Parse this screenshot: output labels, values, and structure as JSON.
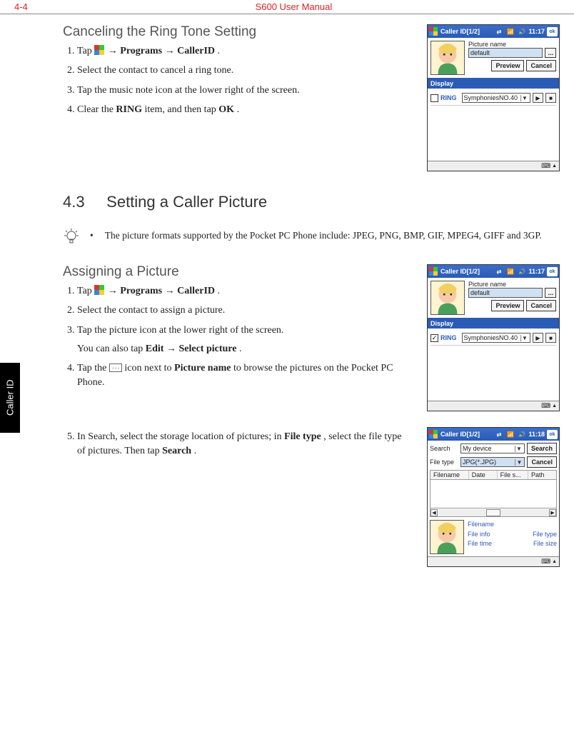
{
  "header": {
    "page_num": "4-4",
    "manual_title": "S600 User Manual"
  },
  "side_tab": "Caller ID",
  "section1": {
    "title": "Canceling the Ring Tone Setting",
    "steps": {
      "s1a": "Tap ",
      "s1b": " → ",
      "s1_prog": "Programs",
      "s1c": " → ",
      "s1_cid": "CallerID",
      "s1d": ".",
      "s2": "Select the contact to cancel a ring tone.",
      "s3": "Tap the music note icon at the lower right of the screen.",
      "s4a": "Clear the ",
      "s4_ring": "RING",
      "s4b": " item, and then tap ",
      "s4_ok": "OK",
      "s4c": "."
    }
  },
  "section_num": {
    "num": "4.3",
    "title": "Setting a Caller Picture"
  },
  "note": {
    "bullet": "•",
    "text": "The picture formats supported by the Pocket PC Phone include: JPEG, PNG, BMP, GIF, MPEG4, GIFF and 3GP."
  },
  "section2": {
    "title": "Assigning a Picture",
    "steps": {
      "s1a": "Tap ",
      "s1b": " → ",
      "s1_prog": "Programs",
      "s1c": " → ",
      "s1_cid": "CallerID",
      "s1d": ".",
      "s2": "Select the contact to assign a picture.",
      "s3": "Tap the picture icon at the lower right of the screen.",
      "s3sub_a": "You can also tap ",
      "s3sub_edit": "Edit",
      "s3sub_b": " → ",
      "s3sub_sel": "Select picture",
      "s3sub_c": ".",
      "s4a": "Tap the ",
      "s4b": " icon next to ",
      "s4_pn": "Picture name",
      "s4c": " to browse the pictures on the Pocket PC Phone.",
      "s5a": "In Search, select the storage location of pictures; in ",
      "s5_ft": "File type",
      "s5b": ", select the file type of pictures. Then tap ",
      "s5_search": "Search",
      "s5c": "."
    }
  },
  "shot1": {
    "title": "Caller ID[1/2]",
    "time": "11:17",
    "picture_name_label": "Picture name",
    "picture_name_value": "default",
    "preview_btn": "Preview",
    "cancel_btn": "Cancel",
    "display_label": "Display",
    "ring_checked": false,
    "ring_label": "RING",
    "ring_value": "SymphoniesNO.40",
    "ok": "ok"
  },
  "shot2": {
    "title": "Caller ID[1/2]",
    "time": "11:17",
    "picture_name_label": "Picture name",
    "picture_name_value": "default",
    "preview_btn": "Preview",
    "cancel_btn": "Cancel",
    "display_label": "Display",
    "ring_checked": true,
    "ring_label": "RING",
    "ring_value": "SymphoniesNO.40",
    "ok": "ok"
  },
  "shot3": {
    "title": "Caller ID[1/2]",
    "time": "11:18",
    "search_label": "Search",
    "search_value": "My device",
    "search_btn": "Search",
    "filetype_label": "File type",
    "filetype_value": "JPG(*.JPG)",
    "cancel_btn": "Cancel",
    "col_filename": "Filename",
    "col_date": "Date",
    "col_filesize": "File s...",
    "col_path": "Path",
    "detail_filename": "Filename",
    "detail_fileinfo": "File info",
    "detail_filetype": "File type",
    "detail_filetime": "File time",
    "detail_filesize": "File size",
    "ok": "ok"
  }
}
